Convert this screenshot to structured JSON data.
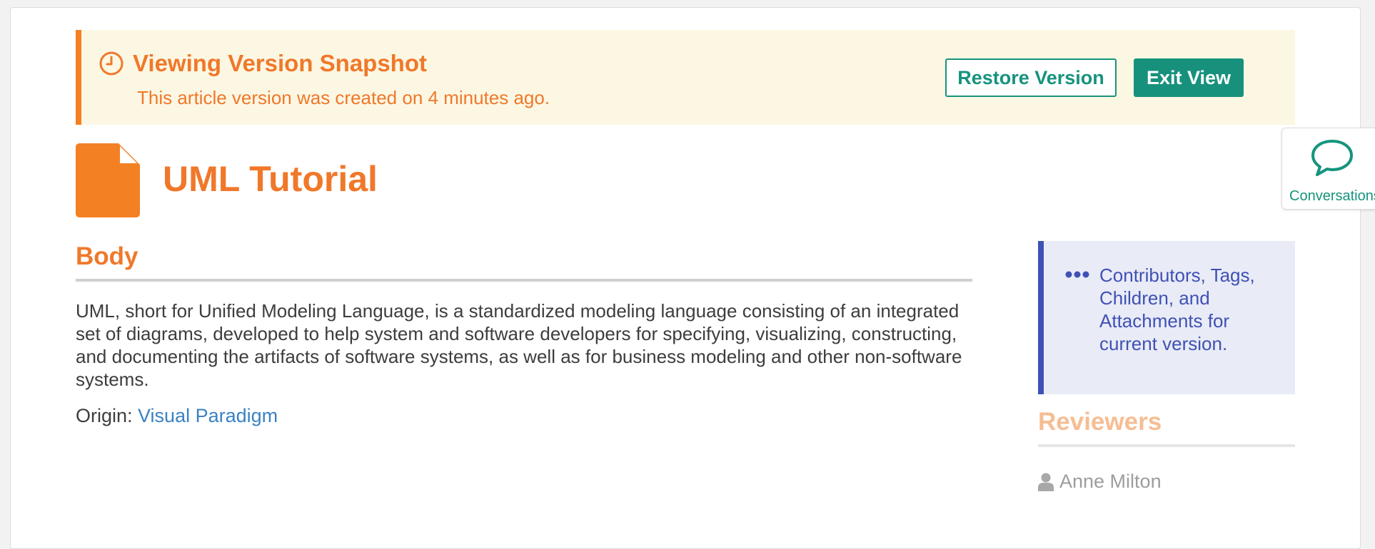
{
  "banner": {
    "title": "Viewing Version Snapshot",
    "subtitle": "This article version was created on 4 minutes ago.",
    "restore_label": "Restore Version",
    "exit_label": "Exit View",
    "icon": "clock-icon"
  },
  "article": {
    "title": "UML Tutorial",
    "icon": "document-icon"
  },
  "conversations": {
    "label": "Conversations",
    "icon": "speech-bubble-icon"
  },
  "body": {
    "heading": "Body",
    "text": "UML, short for Unified Modeling Language, is a standardized modeling language consisting of an integrated set of diagrams, developed to help system and software developers for specifying, visualizing, constructing, and documenting the artifacts of software systems, as well as for business modeling and other non-software systems.",
    "origin_label": "Origin: ",
    "origin_link": "Visual Paradigm"
  },
  "sidebar": {
    "info_text": "Contributors, Tags, Children, and Attachments for current version.",
    "reviewers_heading": "Reviewers",
    "reviewers": [
      "Anne Milton"
    ]
  },
  "colors": {
    "accent_orange": "#f0782a",
    "banner_bg": "#fcf7e3",
    "teal": "#17917c",
    "indigo": "#3f51b5",
    "link_blue": "#3a82c4"
  }
}
